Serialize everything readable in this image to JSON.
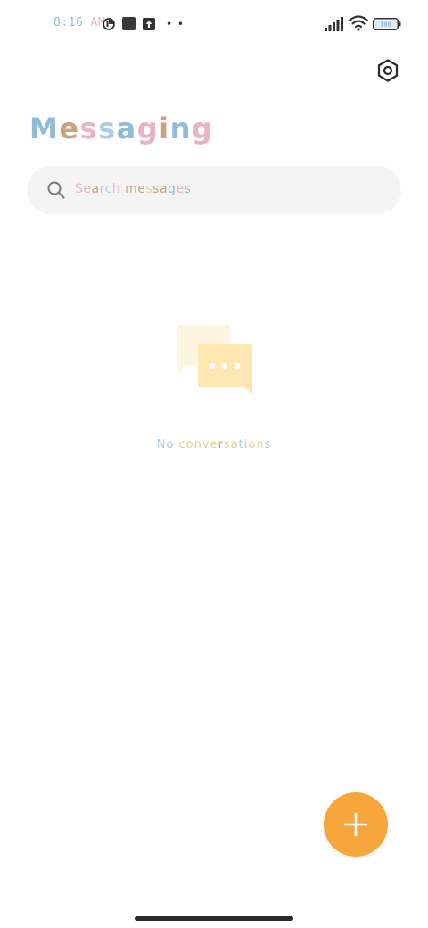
{
  "status_bar": {
    "time_hour": "8:16",
    "time_ampm": "AM",
    "battery_level": "100",
    "icons": [
      "pie-icon",
      "square-icon",
      "upload-icon",
      "more-dots-icon",
      "signal-icon",
      "wifi-icon",
      "battery-icon"
    ]
  },
  "header": {
    "title_letters": [
      "M",
      "e",
      "s",
      "s",
      "a",
      "g",
      "i",
      "n",
      "g"
    ],
    "settings_icon": "settings-icon"
  },
  "search": {
    "placeholder_letters": [
      "S",
      "e",
      "a",
      "r",
      "c",
      "h",
      " ",
      "m",
      "e",
      "s",
      "s",
      "a",
      "g",
      "e",
      "s"
    ],
    "value": ""
  },
  "empty_state": {
    "message_letters": [
      "N",
      "o",
      " ",
      "c",
      "o",
      "n",
      "v",
      "e",
      "r",
      "s",
      "a",
      "t",
      "i",
      "o",
      "n",
      "s"
    ],
    "illustration": "chat-bubbles-icon"
  },
  "fab": {
    "icon": "plus-icon"
  },
  "colors": {
    "accent": "#f5a73b",
    "letter_blue": "#8fbdd9",
    "letter_pink": "#e8b4c4",
    "letter_brown": "#c9a27e",
    "search_bg": "#f4f4f4",
    "bubble_light": "#fef5e0",
    "bubble_main": "#fde6b0"
  }
}
